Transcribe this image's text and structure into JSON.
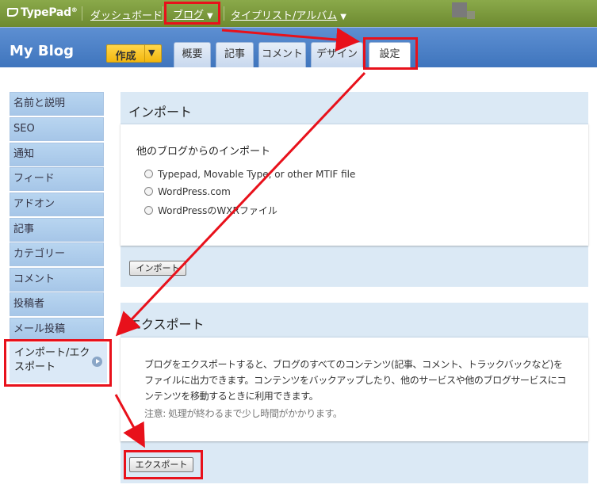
{
  "brand": {
    "logo_text": "TypePad",
    "reg": "®"
  },
  "topbar": {
    "nav": [
      {
        "label": "ダッシュボード"
      },
      {
        "label": "ブログ"
      },
      {
        "label": "タイプリスト/アルバム"
      }
    ]
  },
  "header": {
    "blog_title": "My Blog",
    "create_label": "作成",
    "tabs": [
      {
        "label": "概要"
      },
      {
        "label": "記事"
      },
      {
        "label": "コメント"
      },
      {
        "label": "デザイン"
      },
      {
        "label": "設定"
      }
    ]
  },
  "sidebar": {
    "items": [
      {
        "label": "名前と説明"
      },
      {
        "label": "SEO"
      },
      {
        "label": "通知"
      },
      {
        "label": "フィード"
      },
      {
        "label": "アドオン"
      },
      {
        "label": "記事"
      },
      {
        "label": "カテゴリー"
      },
      {
        "label": "コメント"
      },
      {
        "label": "投稿者"
      },
      {
        "label": "メール投稿"
      }
    ],
    "current_line1": "インポート/エク",
    "current_line2": "スポート"
  },
  "import_panel": {
    "title": "インポート",
    "subtitle": "他のブログからのインポート",
    "options": [
      {
        "label": "Typepad, Movable Type, or other MTIF file"
      },
      {
        "label": "WordPress.com"
      },
      {
        "label": "WordPressのWXRファイル"
      }
    ],
    "button_label": "インポート"
  },
  "export_panel": {
    "title": "エクスポート",
    "description": "ブログをエクスポートすると、ブログのすべてのコンテンツ(記事、コメント、トラックバックなど)をファイルに出力できます。コンテンツをバックアップしたり、他のサービスや他のブログサービスにコンテンツを移動するときに利用できます。",
    "note": "注意: 処理が終わるまで少し時間がかかります。",
    "button_label": "エクスポート"
  },
  "colors": {
    "topbar": "#7c9a3c",
    "header": "#4a80c6",
    "highlight": "#e8111b",
    "create_button": "#f5be1c"
  },
  "icons": {
    "logo": "typepad-logo-icon",
    "dropdown": "caret-down-icon",
    "current_item": "play-circle-icon"
  }
}
